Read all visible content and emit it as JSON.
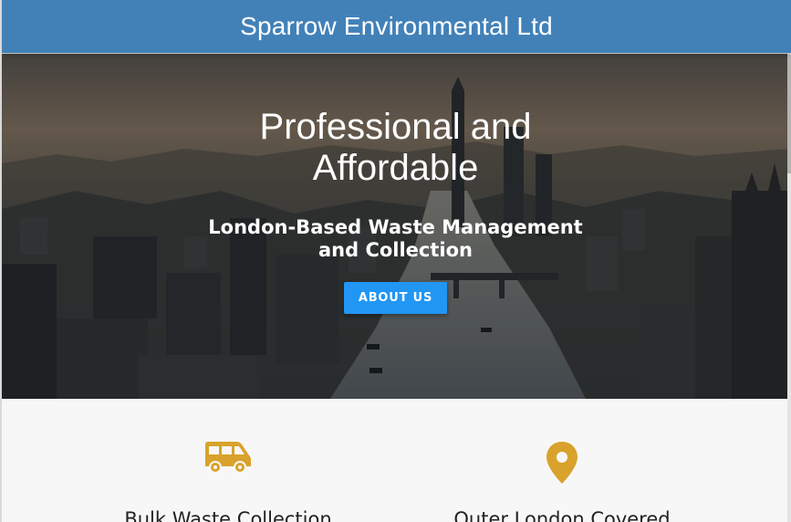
{
  "navbar": {
    "brand": "Sparrow Environmental Ltd"
  },
  "hero": {
    "title": "Professional and Affordable",
    "subtitle": "London-Based Waste Management and Collection",
    "button_label": "ABOUT US"
  },
  "features": [
    {
      "icon": "truck-icon",
      "label": "Bulk Waste Collection"
    },
    {
      "icon": "map-pin-icon",
      "label": "Outer London Covered"
    }
  ],
  "colors": {
    "navbar": "#4281b8",
    "button": "#2196f3",
    "icon_accent": "#d9a22c"
  }
}
